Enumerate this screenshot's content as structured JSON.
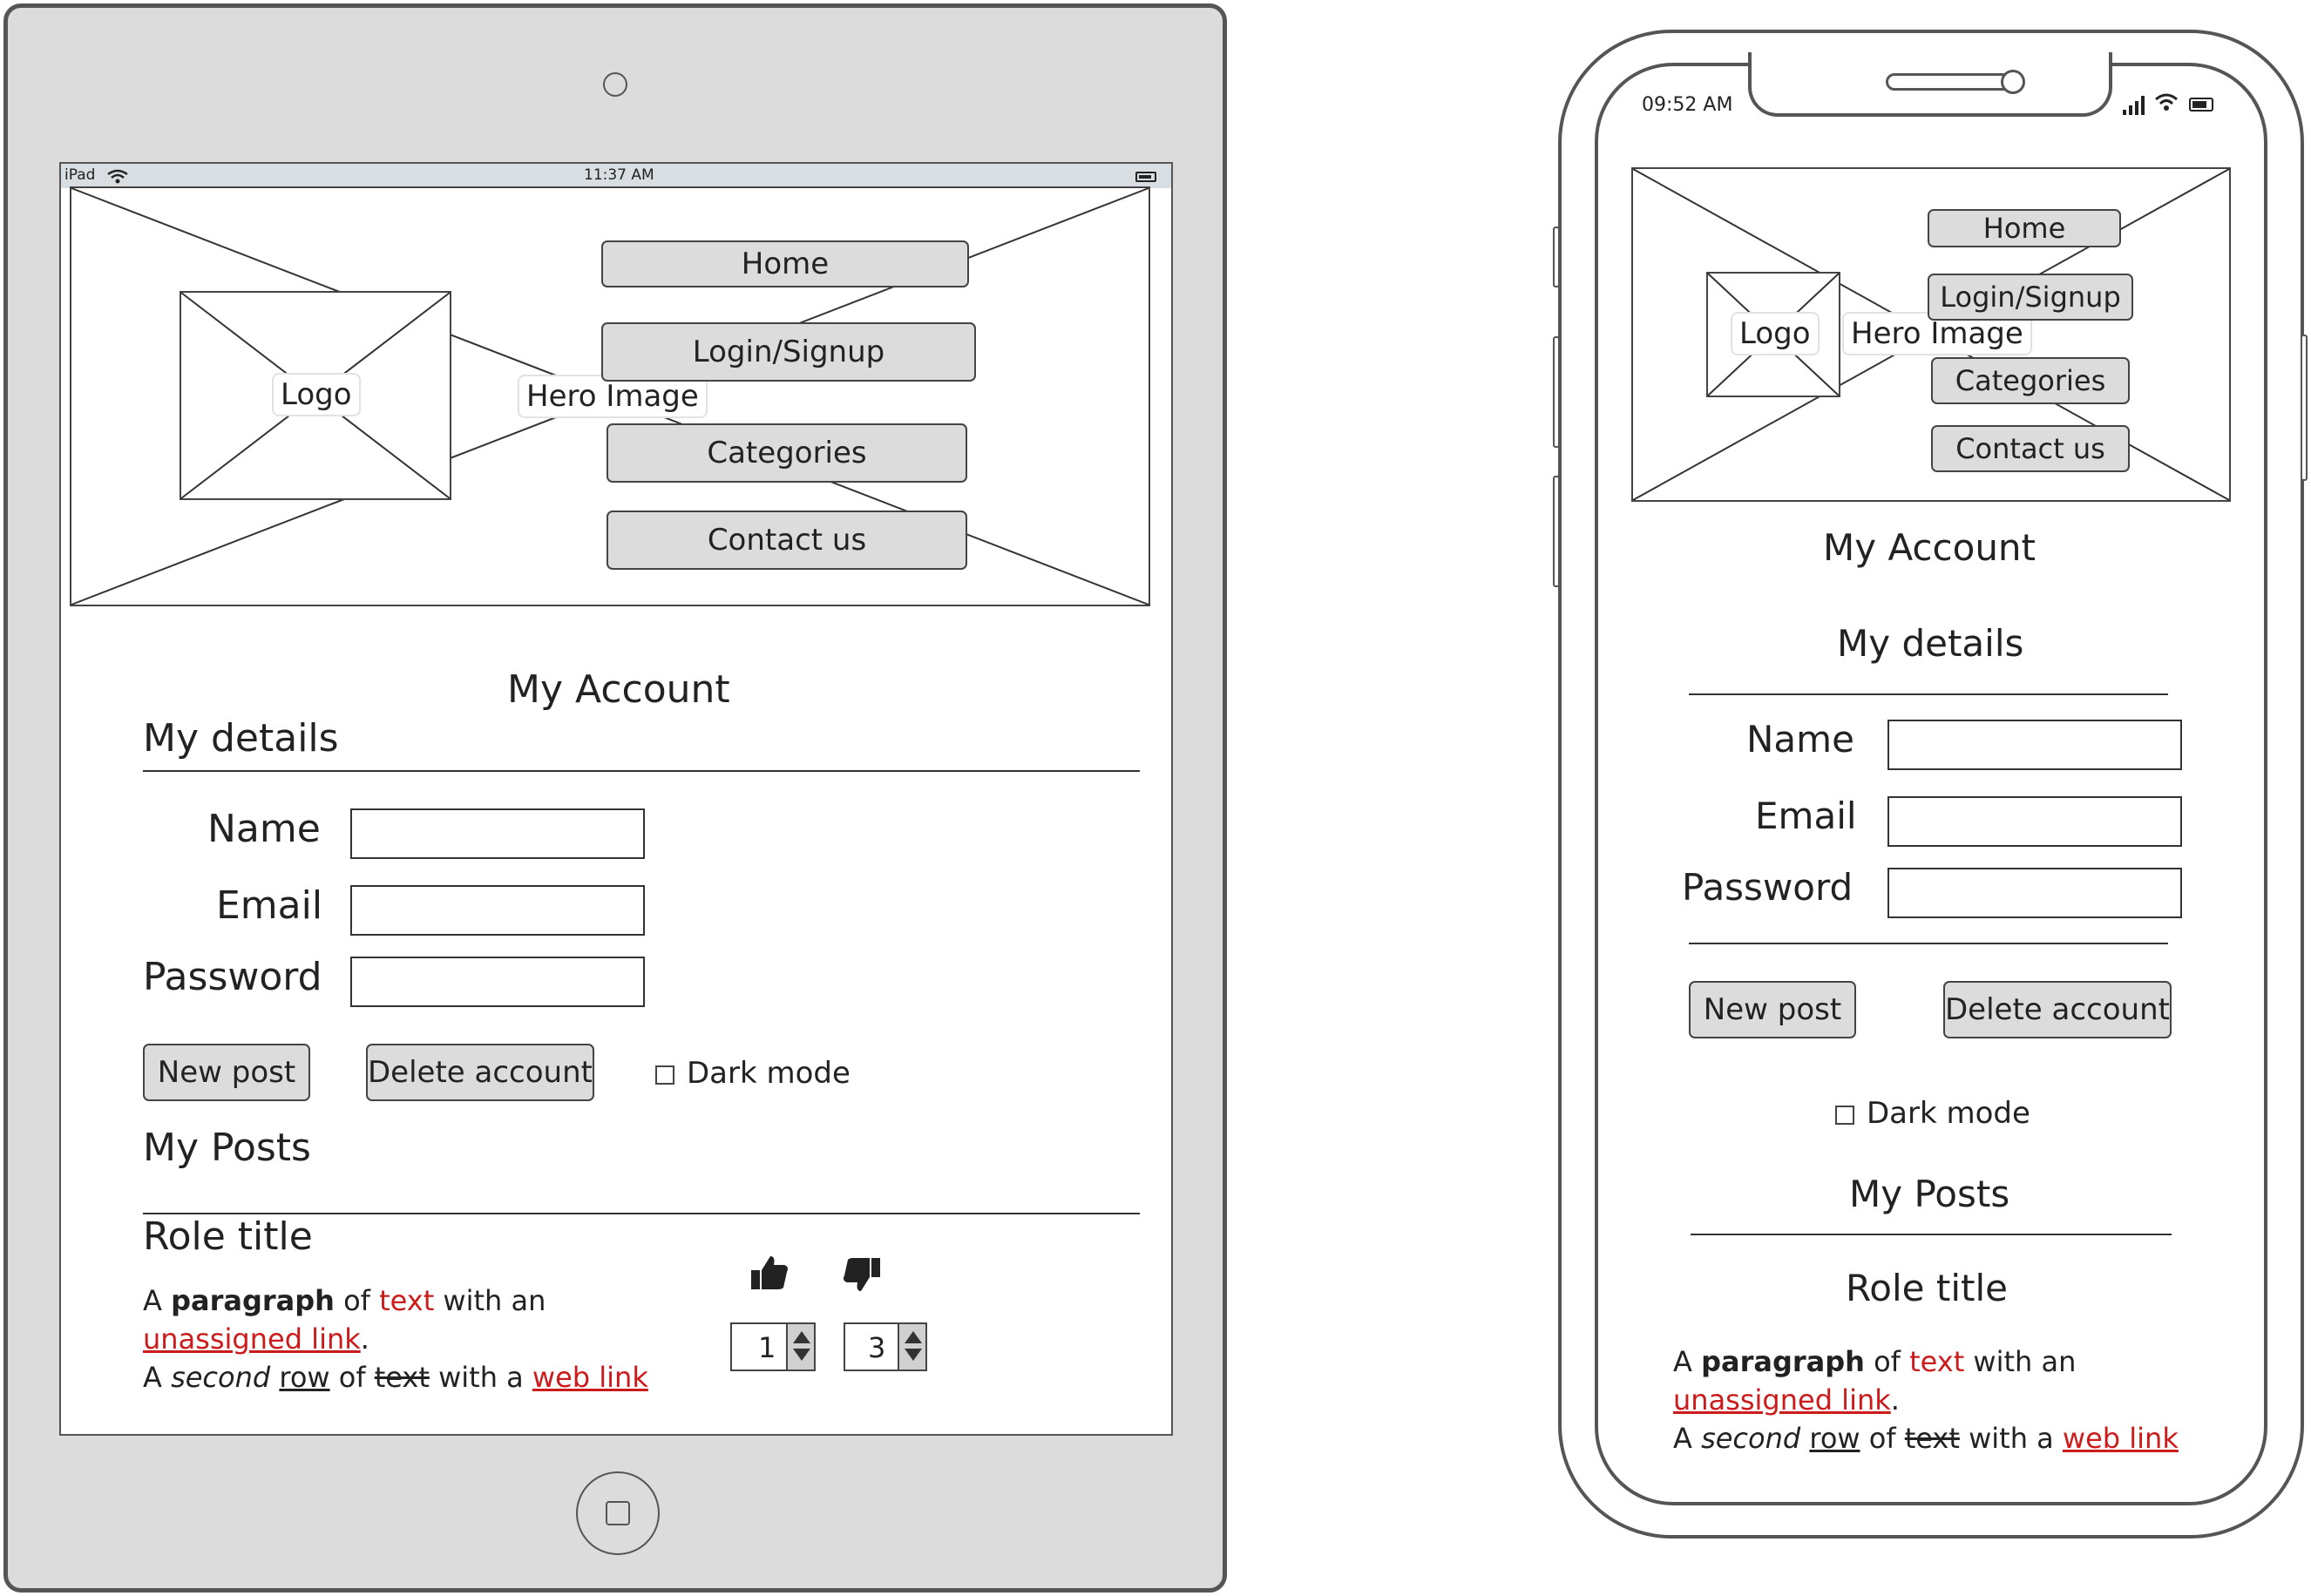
{
  "tablet": {
    "status_bar": {
      "device": "iPad",
      "time": "11:37 AM"
    },
    "header": {
      "logo_label": "Logo",
      "hero_label": "Hero Image",
      "nav": [
        "Home",
        "Login/Signup",
        "Categories",
        "Contact us"
      ]
    },
    "page_title": "My Account",
    "details_heading": "My details",
    "form": {
      "name_label": "Name",
      "email_label": "Email",
      "password_label": "Password",
      "name_value": "",
      "email_value": "",
      "password_value": ""
    },
    "buttons": {
      "new_post": "New post",
      "delete_account": "Delete account"
    },
    "dark_mode_label": "Dark mode",
    "posts_heading": "My Posts",
    "post": {
      "title": "Role title",
      "p1_a": "A ",
      "p1_bold": "paragraph",
      "p1_b": " of ",
      "p1_red": "text",
      "p1_c": " with an",
      "p1_link": "unassigned link",
      "p1_end": ".",
      "p2_a": "A ",
      "p2_italic": "second",
      "p2_b": " ",
      "p2_underline": "row",
      "p2_c": " of ",
      "p2_strike": "text",
      "p2_d": " with a ",
      "p2_link": "web link"
    },
    "votes": {
      "up_count": "1",
      "down_count": "3"
    }
  },
  "phone": {
    "status_bar": {
      "time": "09:52 AM"
    },
    "header": {
      "logo_label": "Logo",
      "hero_label": "Hero Image",
      "nav": [
        "Home",
        "Login/Signup",
        "Categories",
        "Contact us"
      ]
    },
    "page_title": "My Account",
    "details_heading": "My details",
    "form": {
      "name_label": "Name",
      "email_label": "Email",
      "password_label": "Password",
      "name_value": "",
      "email_value": "",
      "password_value": ""
    },
    "buttons": {
      "new_post": "New post",
      "delete_account": "Delete account"
    },
    "dark_mode_label": "Dark mode",
    "posts_heading": "My Posts",
    "post": {
      "title": "Role title",
      "p1_a": "A ",
      "p1_bold": "paragraph",
      "p1_b": " of ",
      "p1_red": "text",
      "p1_c": " with an",
      "p1_link": "unassigned link",
      "p1_end": ".",
      "p2_a": "A ",
      "p2_italic": "second",
      "p2_b": " ",
      "p2_underline": "row",
      "p2_c": " of ",
      "p2_strike": "text",
      "p2_d": " with a ",
      "p2_link": "web link"
    }
  },
  "colors": {
    "tablet_frame": "#dcdcdc",
    "button_fill": "#dcdcdc",
    "link_red": "#cc1b1b"
  },
  "icons": [
    "wifi-icon",
    "battery-icon",
    "signal-icon",
    "thumbs-up-icon",
    "thumbs-down-icon",
    "home-button-icon",
    "camera-icon"
  ]
}
